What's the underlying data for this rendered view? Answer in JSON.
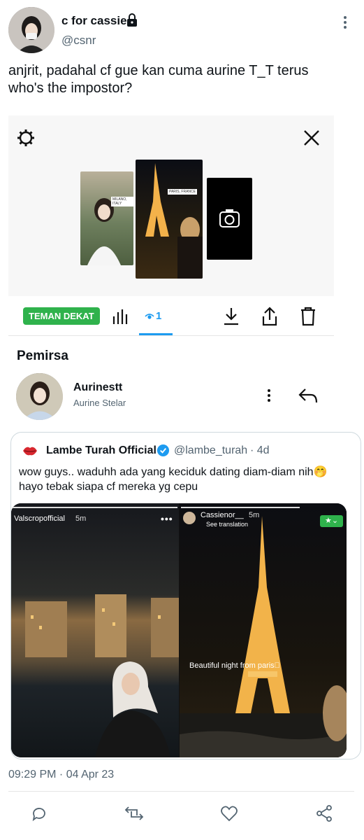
{
  "tweet": {
    "author_name": "c for cassie",
    "author_handle": "@csnr",
    "text_line1": "anjrit, padahal cf gue kan cuma aurine T_T terus",
    "text_line2": "who's the impostor?",
    "timestamp": "09:29 PM · 04 Apr 23"
  },
  "story_viewer": {
    "close_friends_label": "TEMAN DEKAT",
    "viewer_count": "1",
    "thumb1_label": "MILANO, ITALY",
    "thumb2_label": "PARIS, FRANCE",
    "viewers_heading": "Pemirsa",
    "viewer_username": "Aurinestt",
    "viewer_fullname": "Aurine Stelar"
  },
  "quote": {
    "author_name": "Lambe Turah Official",
    "author_handle": "@lambe_turah",
    "time": "· 4d",
    "text_line1": "wow guys.. waduhh ada yang keciduk dating diam-diam nih🤭",
    "text_line2": "hayo tebak siapa cf mereka yg cepu",
    "left_story_user": "Valscropofficial",
    "left_story_time": "5m",
    "right_story_user": "Cassienor__",
    "right_story_time": "5m",
    "right_story_translate": "See translation",
    "right_story_caption": "Beautiful night from paris⃞"
  },
  "colors": {
    "close_friends_green": "#2fb24c",
    "verified_blue": "#1d9bf0",
    "text_primary": "#0f1419",
    "text_muted": "#536471"
  }
}
